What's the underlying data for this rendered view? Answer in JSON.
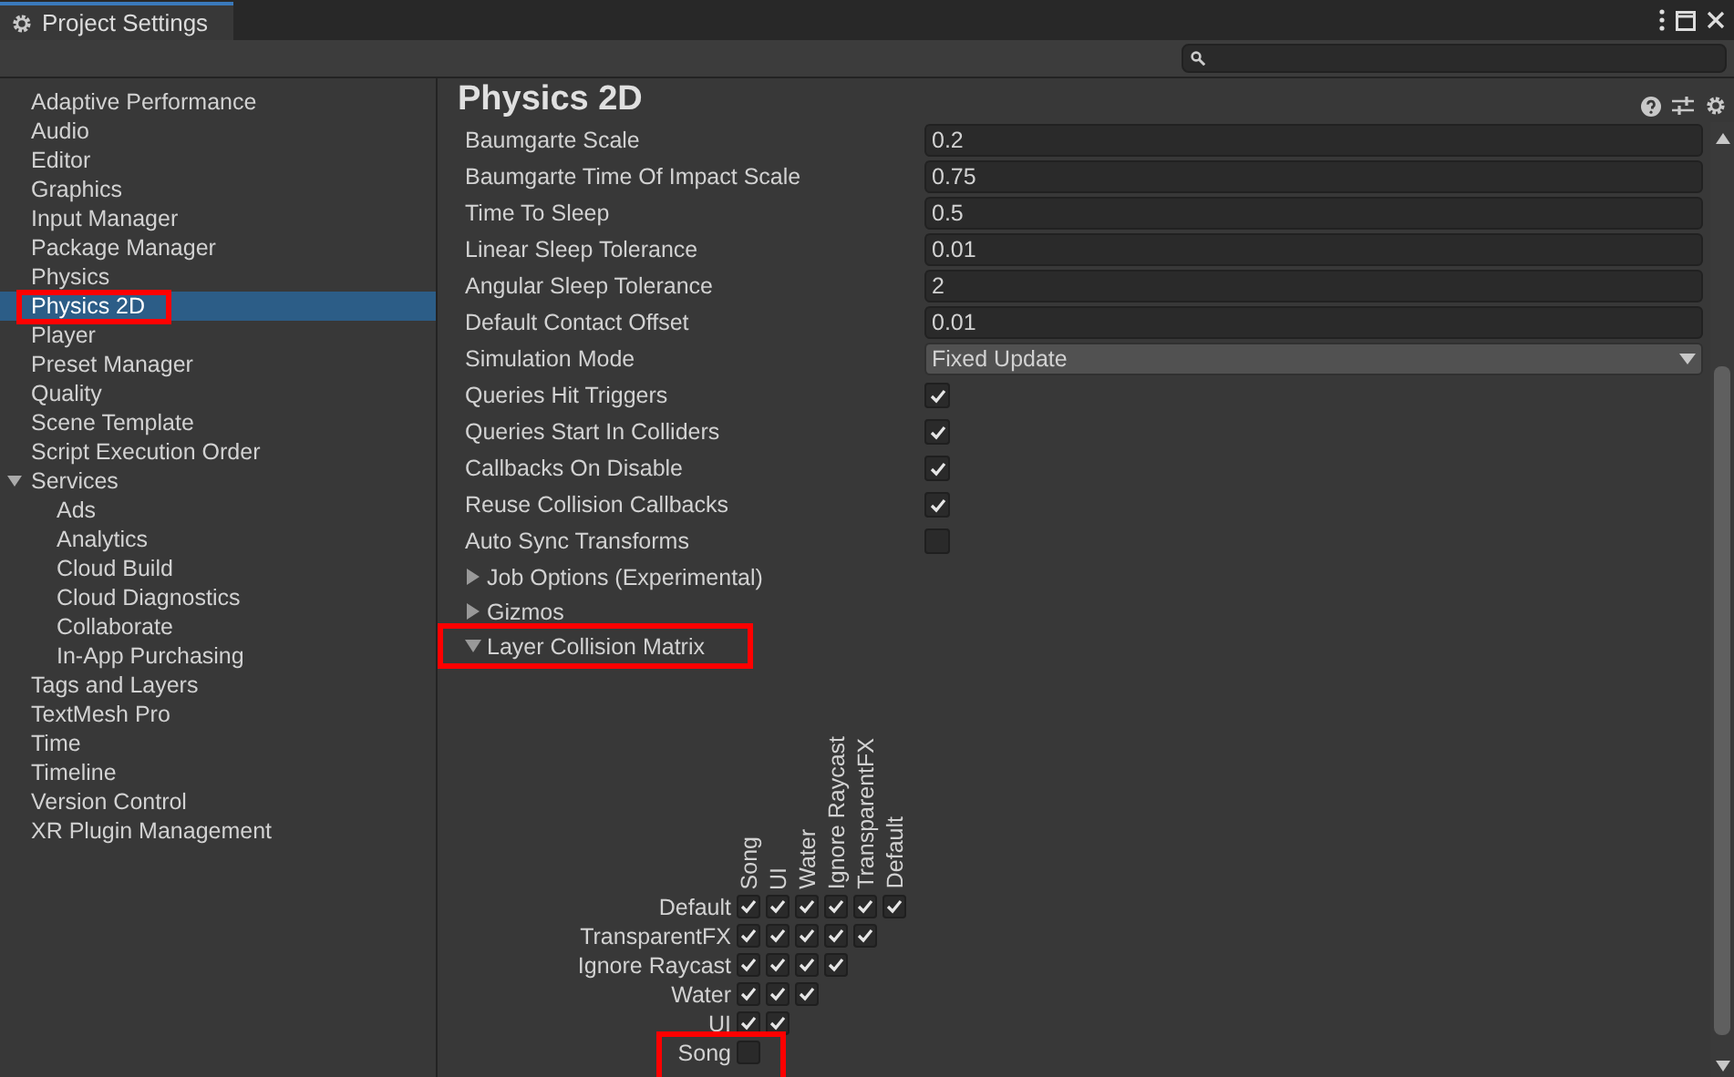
{
  "window": {
    "title": "Project Settings"
  },
  "sidebar": {
    "items": [
      {
        "label": "Adaptive Performance",
        "selected": false
      },
      {
        "label": "Audio",
        "selected": false
      },
      {
        "label": "Editor",
        "selected": false
      },
      {
        "label": "Graphics",
        "selected": false
      },
      {
        "label": "Input Manager",
        "selected": false
      },
      {
        "label": "Package Manager",
        "selected": false
      },
      {
        "label": "Physics",
        "selected": false
      },
      {
        "label": "Physics 2D",
        "selected": true,
        "annotated": true
      },
      {
        "label": "Player",
        "selected": false
      },
      {
        "label": "Preset Manager",
        "selected": false
      },
      {
        "label": "Quality",
        "selected": false
      },
      {
        "label": "Scene Template",
        "selected": false
      },
      {
        "label": "Script Execution Order",
        "selected": false
      },
      {
        "label": "Services",
        "selected": false,
        "expanded": true,
        "children": [
          {
            "label": "Ads",
            "selected": false
          },
          {
            "label": "Analytics",
            "selected": false
          },
          {
            "label": "Cloud Build",
            "selected": false
          },
          {
            "label": "Cloud Diagnostics",
            "selected": false
          },
          {
            "label": "Collaborate",
            "selected": false
          },
          {
            "label": "In-App Purchasing",
            "selected": false
          }
        ]
      },
      {
        "label": "Tags and Layers",
        "selected": false
      },
      {
        "label": "TextMesh Pro",
        "selected": false
      },
      {
        "label": "Time",
        "selected": false
      },
      {
        "label": "Timeline",
        "selected": false
      },
      {
        "label": "Version Control",
        "selected": false
      },
      {
        "label": "XR Plugin Management",
        "selected": false
      }
    ]
  },
  "panel": {
    "title": "Physics 2D",
    "rows": [
      {
        "kind": "number",
        "label": "Baumgarte Scale",
        "value": "0.2"
      },
      {
        "kind": "number",
        "label": "Baumgarte Time Of Impact Scale",
        "value": "0.75"
      },
      {
        "kind": "number",
        "label": "Time To Sleep",
        "value": "0.5"
      },
      {
        "kind": "number",
        "label": "Linear Sleep Tolerance",
        "value": "0.01"
      },
      {
        "kind": "number",
        "label": "Angular Sleep Tolerance",
        "value": "2"
      },
      {
        "kind": "number",
        "label": "Default Contact Offset",
        "value": "0.01"
      },
      {
        "kind": "dropdown",
        "label": "Simulation Mode",
        "value": "Fixed Update"
      },
      {
        "kind": "checkbox",
        "label": "Queries Hit Triggers",
        "checked": true
      },
      {
        "kind": "checkbox",
        "label": "Queries Start In Colliders",
        "checked": true
      },
      {
        "kind": "checkbox",
        "label": "Callbacks On Disable",
        "checked": true
      },
      {
        "kind": "checkbox",
        "label": "Reuse Collision Callbacks",
        "checked": true
      },
      {
        "kind": "checkbox",
        "label": "Auto Sync Transforms",
        "checked": false
      },
      {
        "kind": "foldout",
        "label": "Job Options (Experimental)",
        "expanded": false
      },
      {
        "kind": "foldout",
        "label": "Gizmos",
        "expanded": false
      },
      {
        "kind": "foldout",
        "label": "Layer Collision Matrix",
        "expanded": true,
        "annotated": true
      }
    ],
    "matrix": {
      "columns": [
        "Song",
        "UI",
        "Water",
        "Ignore Raycast",
        "TransparentFX",
        "Default"
      ],
      "rows": [
        {
          "label": "Default",
          "cells": [
            true,
            true,
            true,
            true,
            true,
            true
          ]
        },
        {
          "label": "TransparentFX",
          "cells": [
            true,
            true,
            true,
            true,
            true
          ]
        },
        {
          "label": "Ignore Raycast",
          "cells": [
            true,
            true,
            true,
            true
          ]
        },
        {
          "label": "Water",
          "cells": [
            true,
            true,
            true
          ]
        },
        {
          "label": "UI",
          "cells": [
            true,
            true
          ]
        },
        {
          "label": "Song",
          "cells": [
            false
          ],
          "annotated": true
        }
      ]
    }
  }
}
